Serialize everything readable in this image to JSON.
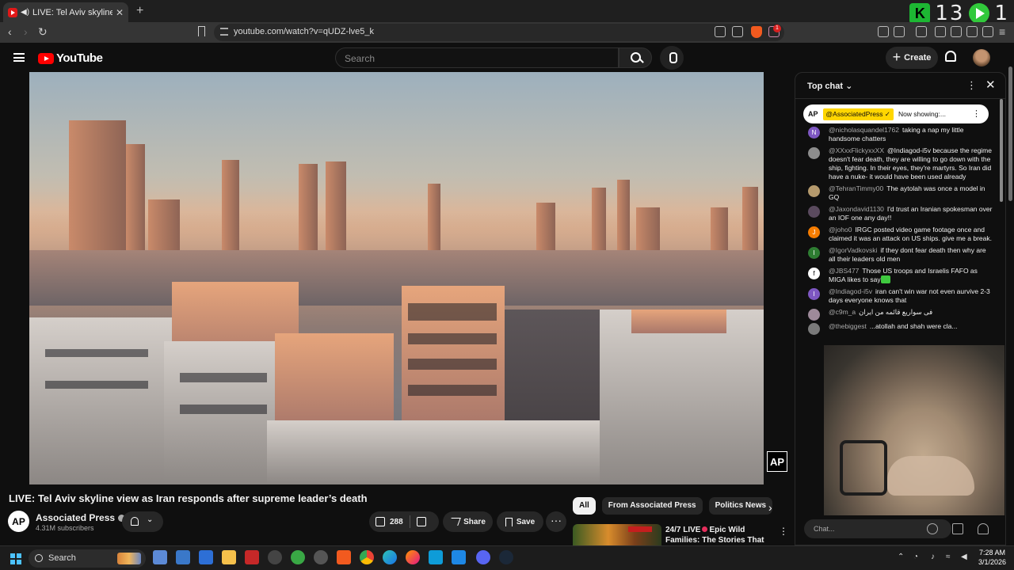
{
  "browser": {
    "tab_title": "LIVE: Tel Aviv skyline view as I",
    "new_tab": "+",
    "url": "youtube.com/watch?v=qUDZ-lve5_k",
    "badge_count": "1",
    "overlay_stat_1": "13",
    "overlay_stat_2": "1",
    "overlay_k": "K"
  },
  "youtube": {
    "logo_text": "YouTube",
    "search_placeholder": "Search",
    "create_label": "Create"
  },
  "video": {
    "title": "LIVE: Tel Aviv skyline view as Iran responds after supreme leader’s death",
    "watermark": "AP",
    "channel": {
      "logo": "AP",
      "name": "Associated Press",
      "subscribers": "4.31M subscribers"
    },
    "likes": "288",
    "share_label": "Share",
    "save_label": "Save",
    "more_label": "···"
  },
  "recommendations": {
    "chips": [
      "All",
      "From Associated Press",
      "Politics News"
    ],
    "next": "›",
    "items": [
      {
        "title_line1": "24/7 LIVE",
        "title_line2": "Epic Wild Families: The Stories That ..."
      }
    ]
  },
  "chat": {
    "header": "Top chat",
    "pinned": {
      "logo": "AP",
      "handle": "@AssociatedPress ✓",
      "text": "Now showing:..."
    },
    "messages": [
      {
        "initial": "N",
        "color": "#7e57c2",
        "author": "@nicholasquandel1762",
        "text": "taking a nap my little handsome chatters"
      },
      {
        "initial": "",
        "color": "#8d8d8d",
        "author": "@XXxxFlickyxxXX",
        "text": "@Indiagod-i5v because the regime doesn't fear death, they are willing to go down with the ship, fighting. In their eyes, they're martyrs. So Iran did have a nuke- it would have been used already"
      },
      {
        "initial": "",
        "color": "#b59a6d",
        "author": "@TehranTimmy00",
        "text": "The aytolah was once a model in GQ"
      },
      {
        "initial": "",
        "color": "#5a4a5e",
        "author": "@Jaxondavid1130",
        "text": "I'd trust an Iranian spokesman over an IOF one any day!!"
      },
      {
        "initial": "J",
        "color": "#f57c00",
        "author": "@joho0",
        "text": "IRGC posted video game footage once and claimed it was an attack on US ships. give me a break."
      },
      {
        "initial": "I",
        "color": "#2e7d32",
        "author": "@IgorVadkovski",
        "text": "if they dont fear death then why are all their leaders old men"
      },
      {
        "initial": "f",
        "color": "#ffffff",
        "author": "@JBS477",
        "text": "Those US troops and Israelis FAFO as MIGA likes to say"
      },
      {
        "initial": "I",
        "color": "#7e57c2",
        "author": "@Indiagod-i5v",
        "text": "iran can't win war not even aurvive 2-3 days everyone knows that"
      },
      {
        "initial": "",
        "color": "#9e8a9a",
        "author": "@c9m_a",
        "text": "فی سواریع قائمه من ایران"
      },
      {
        "initial": "",
        "color": "#7a7a7a",
        "author": "@thebiggest",
        "text": "...atollah and shah were cla..."
      }
    ],
    "input_placeholder": "Chat..."
  },
  "taskbar": {
    "search_label": "Search",
    "time": "7:28 AM",
    "date": "3/1/2026"
  }
}
